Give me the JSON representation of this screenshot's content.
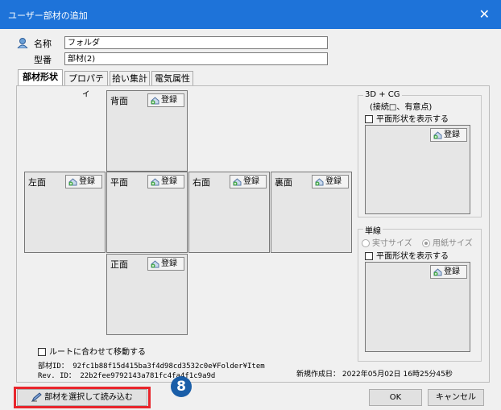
{
  "window": {
    "title": "ユーザー部材の追加",
    "close_glyph": "✕"
  },
  "fields": {
    "name_label": "名称",
    "name_value": "フォルダ",
    "model_label": "型番",
    "model_value": "部材(2)"
  },
  "tabs": [
    {
      "label": "部材形状"
    },
    {
      "label": "プロパティ"
    },
    {
      "label": "拾い集計"
    },
    {
      "label": "電気属性"
    }
  ],
  "faces": {
    "back": "背面",
    "left": "左面",
    "plane": "平面",
    "right": "右面",
    "rear": "裏面",
    "front": "正面"
  },
  "register_label": "登録",
  "cg_group": {
    "title": "3D + CG",
    "subtitle": "(接続□、有意点)",
    "show_plane_label": "平面形状を表示する"
  },
  "line_group": {
    "title": "単線",
    "radio_actual": "実寸サイズ",
    "radio_paper": "用紙サイズ",
    "show_plane_label": "平面形状を表示する"
  },
  "route_check_label": "ルートに合わせて移動する",
  "info": {
    "part_id": "部材ID： 92fc1b88f15d415ba3f4d98cd3532c0e¥Folder¥Item",
    "rev_id": "Rev. ID： 22b2fee9792143a781fc4fa4f1c9a9d",
    "created": "新規作成日： 2022年05月02日 16時25分45秒"
  },
  "buttons": {
    "select_part": "部材を選択して読み込む",
    "ok": "OK",
    "cancel": "キャンセル"
  },
  "callout": {
    "number": "8"
  },
  "colors": {
    "titlebar": "#1e73d9",
    "callout": "#1a5ea8",
    "highlight": "#e8252b"
  }
}
